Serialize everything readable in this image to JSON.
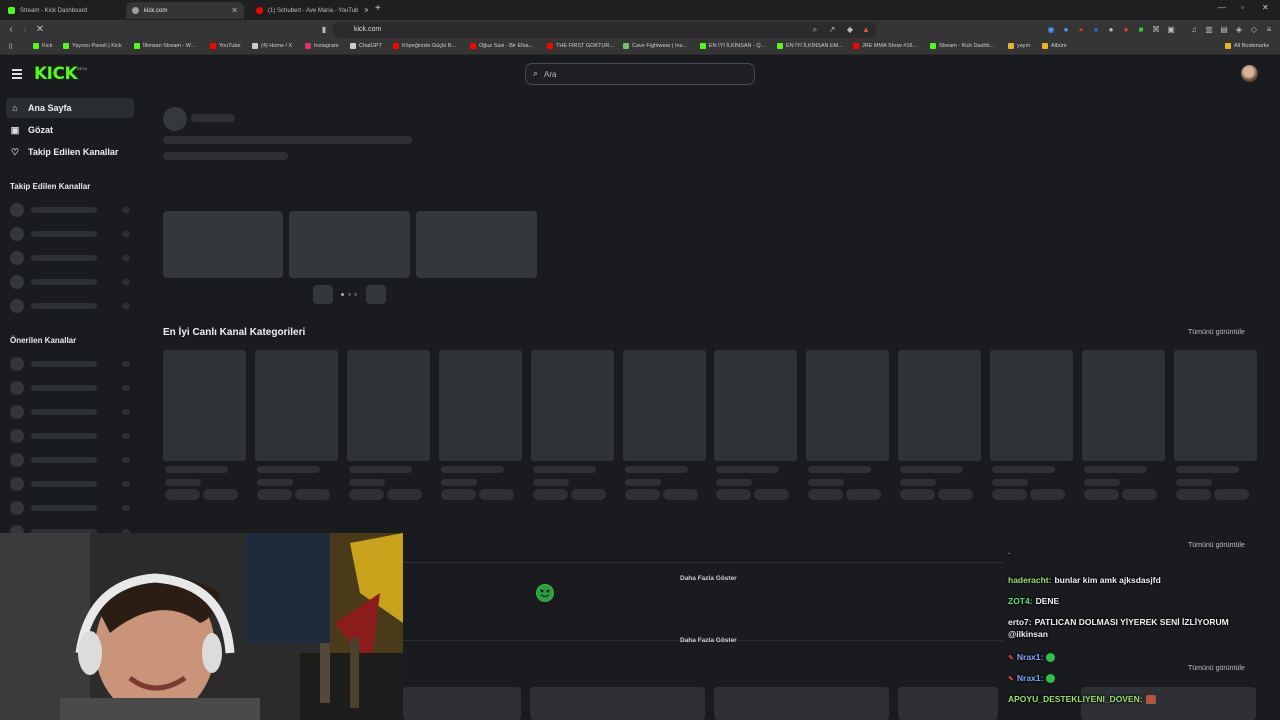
{
  "browser": {
    "tabs": [
      {
        "title": "Stream - Kick Dashboard",
        "color": "#53fc18"
      },
      {
        "title": "kick.com",
        "color": "#9aa0a6"
      },
      {
        "title": "(1) Schubert - Ave Maria - YouTub",
        "color": "#ff0000"
      }
    ],
    "url": "kick.com",
    "bookmarks": [
      {
        "label": "Kick",
        "color": "#53fc18"
      },
      {
        "label": "Yayıncı Paneli | Kick",
        "color": "#53fc18"
      },
      {
        "label": "İlkinsan Stream - W...",
        "color": "#53fc18"
      },
      {
        "label": "YouTube",
        "color": "#ff0000"
      },
      {
        "label": "(4) Home / X",
        "color": "#cccccc"
      },
      {
        "label": "Instagram",
        "color": "#e1306c"
      },
      {
        "label": "ChatGPT",
        "color": "#cccccc"
      },
      {
        "label": "Köpeğinizle Güçlü B...",
        "color": "#ff0000"
      },
      {
        "label": "Oğuz Sasi - Bir Efsa...",
        "color": "#ff0000"
      },
      {
        "label": "THE FIRST GOKTUR...",
        "color": "#ff0000"
      },
      {
        "label": "Cave Fightwear | Ins...",
        "color": "#6fc36f"
      },
      {
        "label": "EN İYİ İLKİNSAN - Q...",
        "color": "#53fc18"
      },
      {
        "label": "EN İYİ İLKİNSAN EM...",
        "color": "#53fc18"
      },
      {
        "label": "JRE MMA Show #16...",
        "color": "#ff0000"
      },
      {
        "label": "Stream - Kick Dashb...",
        "color": "#53fc18"
      },
      {
        "label": "yayın",
        "color": "#e6b422"
      },
      {
        "label": "Albüm",
        "color": "#e6b422"
      }
    ],
    "all_bookmarks": "All Bookmarks"
  },
  "header": {
    "logo": "KICK",
    "logo_badge": "BETA",
    "search_placeholder": "Ara"
  },
  "sidebar": {
    "nav": [
      {
        "label": "Ana Sayfa",
        "icon": "home-icon"
      },
      {
        "label": "Gözat",
        "icon": "browse-icon"
      },
      {
        "label": "Takip Edilen Kanallar",
        "icon": "heart-icon"
      }
    ],
    "followed_heading": "Takip Edilen Kanallar",
    "recommended_heading": "Önerilen Kanallar"
  },
  "main": {
    "categories_title": "En İyi Canlı Kanal Kategorileri",
    "view_all": "Tümünü görüntüle",
    "show_more": "Daha Fazla Göster"
  },
  "chat": {
    "messages": [
      {
        "user": "haderacht:",
        "text": "bunlar kim amk ajksdasjfd",
        "user_color": "#9be36b"
      },
      {
        "user": "ZOT4:",
        "text": "DENE",
        "user_color": "#5ee07a"
      },
      {
        "user": "erto7:",
        "text": "PATLICAN DOLMASI YİYEREK SENİ İZLİYORUM @ilkinsan",
        "user_color": "#f2f2f2"
      },
      {
        "user": "Nrax1:",
        "text": "",
        "user_color": "#7fa8ff"
      },
      {
        "user": "Nrax1:",
        "text": "",
        "user_color": "#7fa8ff"
      },
      {
        "user": "APOYU_DESTEKLIYENI_DOVEN:",
        "text": "",
        "user_color": "#9be36b"
      }
    ]
  }
}
